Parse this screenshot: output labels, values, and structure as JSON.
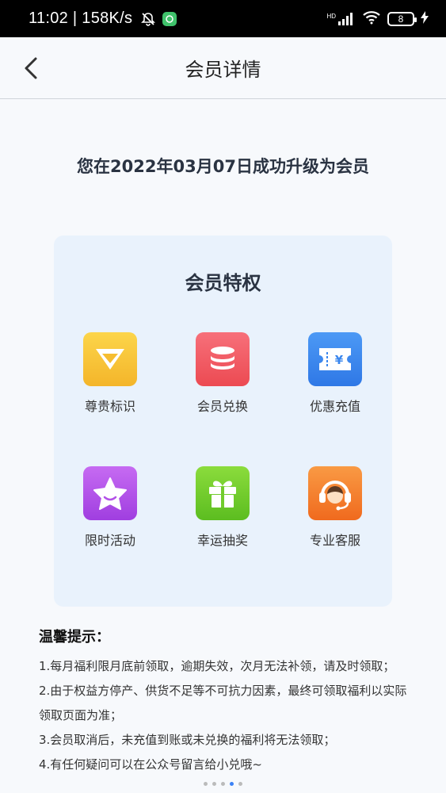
{
  "status_bar": {
    "time": "11:02 | 158K/s",
    "network_label": "HD",
    "battery": "8"
  },
  "nav": {
    "title": "会员详情"
  },
  "upgrade_message": "您在2022年03月07日成功升级为会员",
  "privileges": {
    "title": "会员特权",
    "items": [
      {
        "label": "尊贵标识",
        "icon": "diamond-icon",
        "color": "#f7c43a"
      },
      {
        "label": "会员兑换",
        "icon": "coins-icon",
        "color": "#f0565f"
      },
      {
        "label": "优惠充值",
        "icon": "coupon-icon",
        "color": "#3b87ee"
      },
      {
        "label": "限时活动",
        "icon": "star-icon",
        "color": "#b351e8"
      },
      {
        "label": "幸运抽奖",
        "icon": "gift-icon",
        "color": "#72cc2c"
      },
      {
        "label": "专业客服",
        "icon": "headset-icon",
        "color": "#f57d2a"
      }
    ]
  },
  "tips": {
    "title": "温馨提示：",
    "lines": [
      "1.每月福利限月底前领取，逾期失效，次月无法补领，请及时领取；",
      "2.由于权益方停产、供货不足等不可抗力因素，最终可领取福利以实际领取页面为准；",
      "3.会员取消后，未充值到账或未兑换的福利将无法领取；",
      "4.有任何疑问可以在公众号留言给小兑哦~"
    ]
  }
}
